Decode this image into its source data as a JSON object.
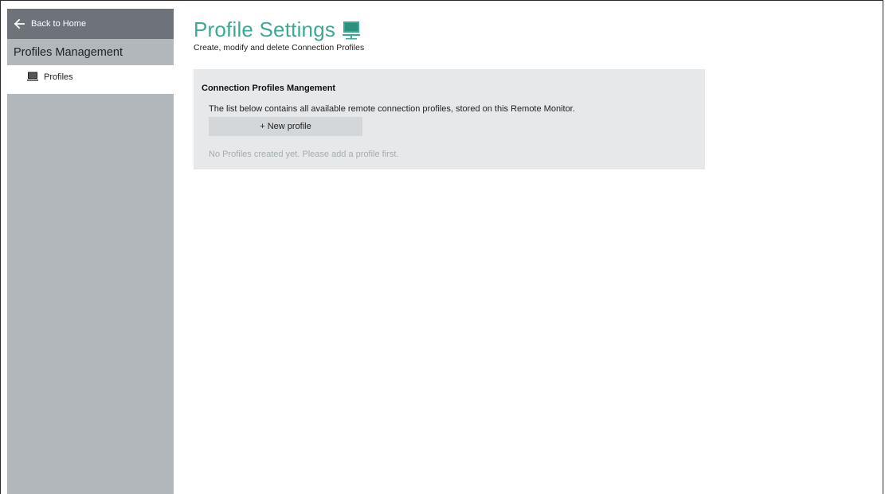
{
  "sidebar": {
    "back_label": "Back to Home",
    "back_icon": "arrow-left-icon",
    "section_title": "Profiles Management",
    "items": [
      {
        "label": "Profiles",
        "icon": "monitor-icon",
        "selected": true
      }
    ]
  },
  "main": {
    "title": "Profile Settings",
    "title_icon": "monitor-network-icon",
    "subtitle": "Create, modify and delete Connection Profiles",
    "panel": {
      "heading": "Connection Profiles Mangement",
      "description": "The list below contains all available remote connection profiles, stored on this Remote Monitor.",
      "new_button_label": "+ New profile",
      "empty_message": "No Profiles created yet. Please add a profile first."
    }
  },
  "colors": {
    "accent": "#3aaa96",
    "sidebar_bg": "#b1b7bb",
    "back_bar_bg": "#6d7378",
    "panel_bg": "#e6e8e9",
    "button_bg": "#d4d7d9",
    "muted_text": "#a5adb2"
  }
}
